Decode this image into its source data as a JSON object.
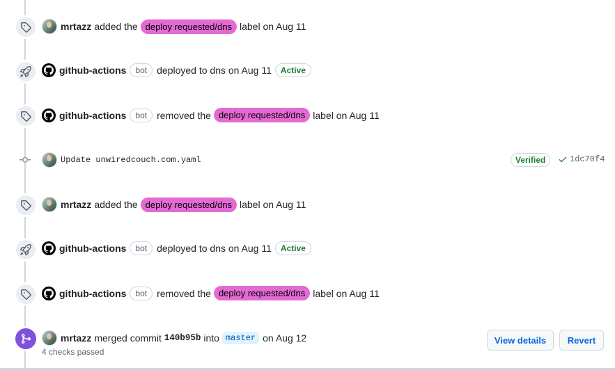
{
  "events": [
    {
      "type": "label_added",
      "icon": "tag-icon",
      "actor": "mrtazz",
      "verb": "added the",
      "label": "deploy requested/dns",
      "suffix": "label on Aug 11"
    },
    {
      "type": "deployed",
      "icon": "rocket-icon",
      "actor": "github-actions",
      "bot": "bot",
      "text": "deployed to dns on Aug 11",
      "status": "Active"
    },
    {
      "type": "label_removed",
      "icon": "tag-icon",
      "actor": "github-actions",
      "bot": "bot",
      "verb": "removed the",
      "label": "deploy requested/dns",
      "suffix": "label on Aug 11"
    },
    {
      "type": "commit",
      "icon": "commit-icon",
      "message": "Update unwiredcouch.com.yaml",
      "verified": "Verified",
      "sha": "1dc70f4"
    },
    {
      "type": "label_added",
      "icon": "tag-icon",
      "actor": "mrtazz",
      "verb": "added the",
      "label": "deploy requested/dns",
      "suffix": "label on Aug 11"
    },
    {
      "type": "deployed",
      "icon": "rocket-icon",
      "actor": "github-actions",
      "bot": "bot",
      "text": "deployed to dns on Aug 11",
      "status": "Active"
    },
    {
      "type": "label_removed",
      "icon": "tag-icon",
      "actor": "github-actions",
      "bot": "bot",
      "verb": "removed the",
      "label": "deploy requested/dns",
      "suffix": "label on Aug 11"
    }
  ],
  "merge": {
    "icon": "merge-icon",
    "actor": "mrtazz",
    "verb": "merged commit",
    "commit": "140b95b",
    "into": "into",
    "branch": "master",
    "date": "on Aug 12",
    "checks": "4 checks passed",
    "view_details": "View details",
    "revert": "Revert"
  },
  "colors": {
    "label": "#e46ad4",
    "active": "#1a7f37",
    "merge": "#8250df",
    "link": "#0969da"
  }
}
